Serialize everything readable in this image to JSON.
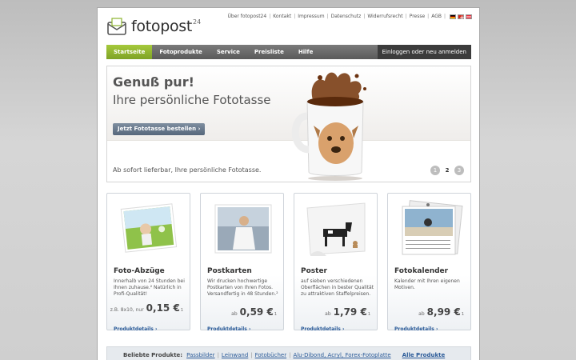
{
  "logo": {
    "name": "fotopost",
    "superscript": "24"
  },
  "toplinks": [
    "Über fotopost24",
    "Kontakt",
    "Impressum",
    "Datenschutz",
    "Widerrufsrecht",
    "Presse",
    "AGB"
  ],
  "nav": {
    "items": [
      "Startseite",
      "Fotoprodukte",
      "Service",
      "Preisliste",
      "Hilfe"
    ],
    "login": "Einloggen oder neu anmelden"
  },
  "hero": {
    "title": "Genuß pur!",
    "subtitle": "Ihre persönliche Fototasse",
    "button": "Jetzt Fototasse bestellen",
    "caption": "Ab sofort lieferbar, Ihre persönliche Fototasse.",
    "pages": [
      "1",
      "2",
      "3"
    ],
    "active_page": 2
  },
  "cards": [
    {
      "title": "Foto-Abzüge",
      "desc": "Innerhalb von 24 Stunden bei Ihnen zuhause.² Natürlich in Profi-Qualität!",
      "price_prefix": "z.B. 8x10, nur",
      "price": "0,15 €",
      "price_sup": "1",
      "link": "Produktdetails"
    },
    {
      "title": "Postkarten",
      "desc": "Wir drucken hochwertige Postkarten von Ihren Fotos. Versandfertig in 48 Stunden.²",
      "price_prefix": "ab",
      "price": "0,59 €",
      "price_sup": "1",
      "link": "Produktdetails"
    },
    {
      "title": "Poster",
      "desc": "auf sieben verschiedenen Oberflächen in bester Qualität zu attraktiven Staffelpreisen.",
      "price_prefix": "ab",
      "price": "1,79 €",
      "price_sup": "1",
      "link": "Produktdetails"
    },
    {
      "title": "Fotokalender",
      "desc": "Kalender mit Ihren eigenen Motiven.",
      "price_prefix": "ab",
      "price": "8,99 €",
      "price_sup": "1",
      "link": "Produktdetails"
    }
  ],
  "popular": {
    "label": "Beliebte Produkte:",
    "links": [
      "Passbilder",
      "Leinwand",
      "Fotobücher",
      "Alu-Dibond, Acryl, Forex-Fotoplatte"
    ],
    "all": "Alle Produkte"
  },
  "colors": {
    "accent_green": "#8db52e",
    "nav_gray": "#6a6a6a",
    "link_blue": "#2a5a98"
  }
}
